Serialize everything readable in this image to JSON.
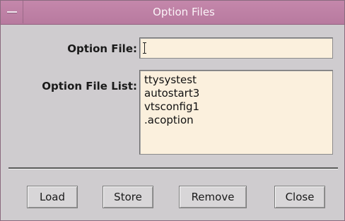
{
  "window": {
    "title": "Option Files"
  },
  "form": {
    "option_file_label": "Option File:",
    "option_file_value": "",
    "option_file_list_label": "Option File List:",
    "option_file_list": [
      "ttysystest",
      "autostart3",
      "vtsconfig1",
      ".acoption"
    ]
  },
  "buttons": {
    "load": "Load",
    "store": "Store",
    "remove": "Remove",
    "close": "Close"
  }
}
